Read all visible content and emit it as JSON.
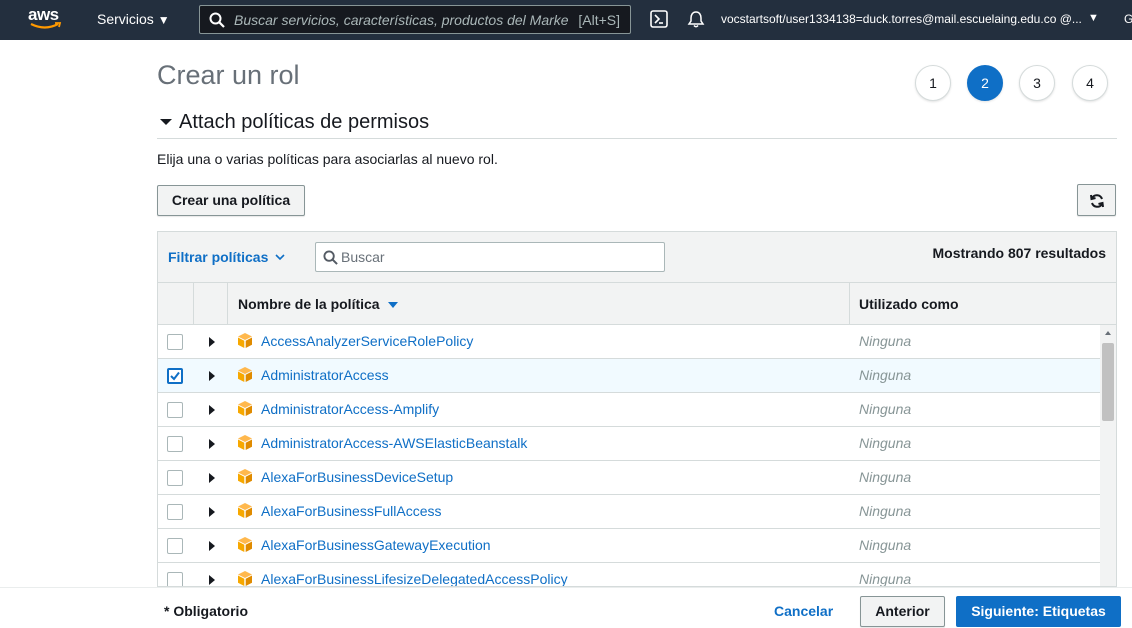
{
  "topnav": {
    "logo_text": "aws",
    "services_label": "Servicios",
    "search_placeholder": "Buscar servicios, características, productos del Marke",
    "search_shortcut": "[Alt+S]",
    "account": "vocstartsoft/user1334138=duck.torres@mail.escuelaing.edu.co @...",
    "region": "G",
    "icons": [
      "cloudshell-icon",
      "bell-icon"
    ]
  },
  "page": {
    "title": "Crear un rol",
    "steps": [
      "1",
      "2",
      "3",
      "4"
    ],
    "active_step": 2,
    "section_title": "Attach políticas de permisos",
    "description": "Elija una o varias políticas para asociarlas al nuevo rol.",
    "create_policy_label": "Crear una política"
  },
  "table": {
    "filter_label": "Filtrar políticas",
    "search_placeholder": "Buscar",
    "results_text": "Mostrando 807 resultados",
    "columns": [
      "Nombre de la política",
      "Utilizado como"
    ],
    "rows": [
      {
        "name": "AccessAnalyzerServiceRolePolicy",
        "used_as": "Ninguna",
        "checked": false
      },
      {
        "name": "AdministratorAccess",
        "used_as": "Ninguna",
        "checked": true
      },
      {
        "name": "AdministratorAccess-Amplify",
        "used_as": "Ninguna",
        "checked": false
      },
      {
        "name": "AdministratorAccess-AWSElasticBeanstalk",
        "used_as": "Ninguna",
        "checked": false
      },
      {
        "name": "AlexaForBusinessDeviceSetup",
        "used_as": "Ninguna",
        "checked": false
      },
      {
        "name": "AlexaForBusinessFullAccess",
        "used_as": "Ninguna",
        "checked": false
      },
      {
        "name": "AlexaForBusinessGatewayExecution",
        "used_as": "Ninguna",
        "checked": false
      },
      {
        "name": "AlexaForBusinessLifesizeDelegatedAccessPolicy",
        "used_as": "Ninguna",
        "checked": false
      }
    ]
  },
  "footer": {
    "required_label": "* Obligatorio",
    "cancel_label": "Cancelar",
    "previous_label": "Anterior",
    "next_label": "Siguiente: Etiquetas"
  },
  "colors": {
    "nav_bg": "#232f3e",
    "link_blue": "#0f6fc6",
    "policy_icon": "#f7a800",
    "selected_row": "#f1faff"
  }
}
